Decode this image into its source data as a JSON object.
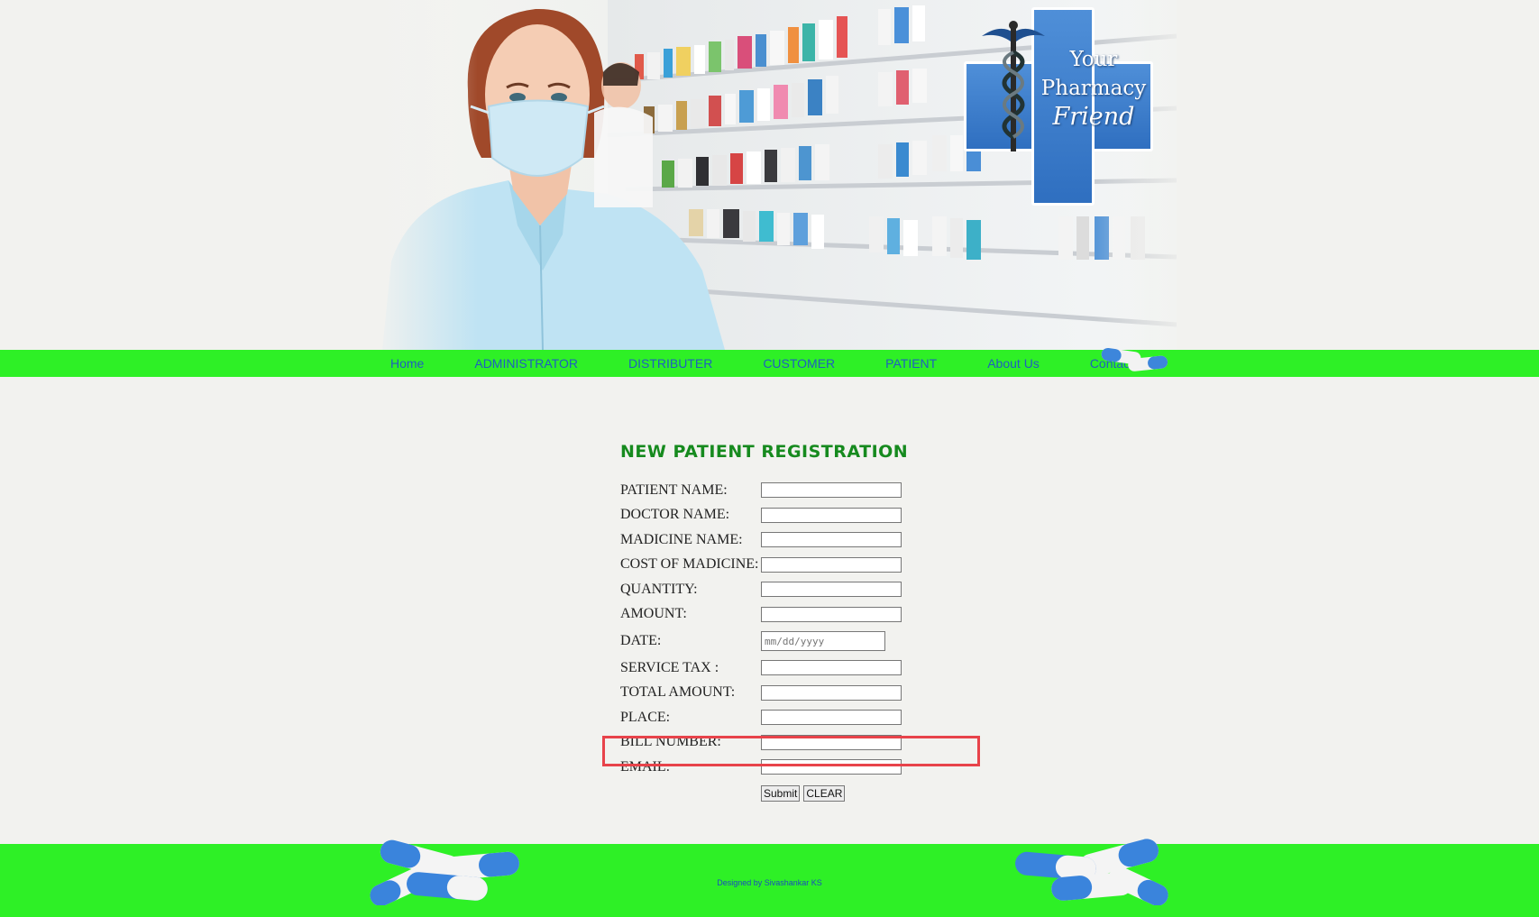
{
  "logo": {
    "line1": "Your",
    "line2": "Pharmacy",
    "line3": "Friend"
  },
  "nav": {
    "items": [
      {
        "label": "Home"
      },
      {
        "label": "ADMINISTRATOR"
      },
      {
        "label": "DISTRIBUTER"
      },
      {
        "label": "CUSTOMER"
      },
      {
        "label": "PATIENT"
      },
      {
        "label": "About Us"
      },
      {
        "label": "Contact Us"
      }
    ]
  },
  "form": {
    "title": "NEW PATIENT REGISTRATION",
    "fields": [
      {
        "label": "PATIENT NAME:",
        "value": ""
      },
      {
        "label": "DOCTOR NAME:",
        "value": ""
      },
      {
        "label": "MADICINE NAME:",
        "value": ""
      },
      {
        "label": "COST OF MADICINE:",
        "value": ""
      },
      {
        "label": "QUANTITY:",
        "value": ""
      },
      {
        "label": "AMOUNT:",
        "value": ""
      },
      {
        "label": "DATE:",
        "placeholder": "mm/dd/yyyy"
      },
      {
        "label": "SERVICE TAX :",
        "value": ""
      },
      {
        "label": "TOTAL AMOUNT:",
        "value": ""
      },
      {
        "label": "PLACE:",
        "value": ""
      },
      {
        "label": "BILL NUMBER:",
        "value": ""
      },
      {
        "label": "EMAIL:",
        "value": ""
      }
    ],
    "submit_label": "Submit",
    "clear_label": "CLEAR"
  },
  "footer": {
    "credit": "Designed by Sivashankar KS"
  },
  "colors": {
    "nav_bg": "#2ef026",
    "link": "#1f5fbf",
    "title": "#168a1e",
    "highlight": "#e8434a"
  }
}
